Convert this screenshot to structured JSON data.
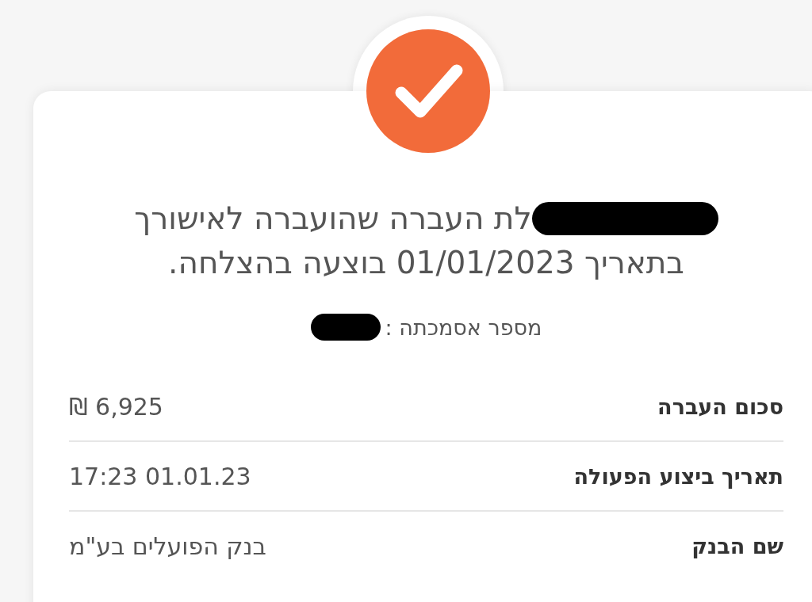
{
  "status": {
    "kind": "success"
  },
  "message": {
    "lines": [
      {
        "text": "לת העברה שהועברה לאישורך",
        "redacted": true
      },
      {
        "text": "בתאריך 01/01/2023 בוצעה בהצלחה.",
        "redacted": false
      }
    ]
  },
  "reference": {
    "label": "מספר אסמכתה :",
    "redacted": true
  },
  "details": [
    {
      "label": "סכום העברה",
      "value": "₪ 6,925"
    },
    {
      "label": "תאריך ביצוע הפעולה",
      "value": "17:23 01.01.23"
    },
    {
      "label": "שם הבנק",
      "value": "בנק הפועלים בע\"מ"
    }
  ]
}
